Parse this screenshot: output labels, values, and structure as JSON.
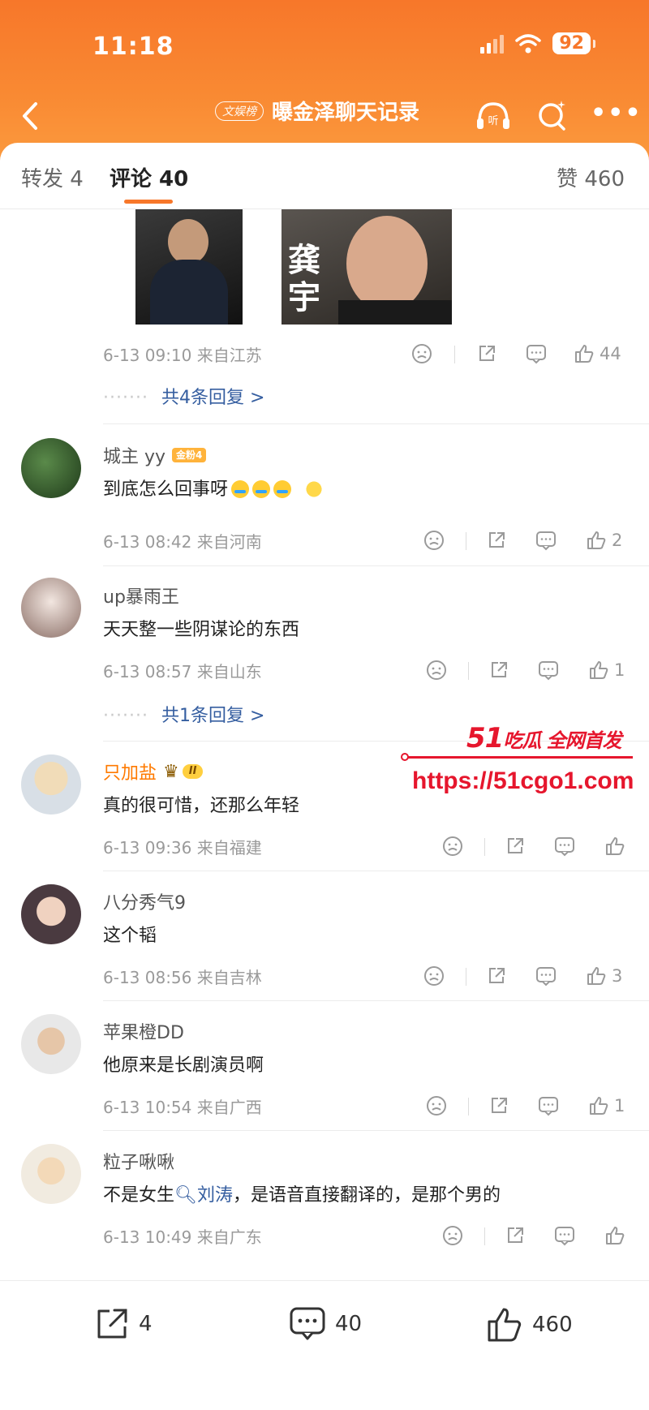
{
  "status_bar": {
    "time": "11:18",
    "battery": "92"
  },
  "nav": {
    "badge": "文娱榜",
    "title": "曝金泽聊天记录"
  },
  "tabs": {
    "repost": "转发 4",
    "comment": "评论 40",
    "like": "赞 460"
  },
  "top_item": {
    "photo_label": "龚宇",
    "meta": "6-13 09:10 来自江苏",
    "likes": "44",
    "replies": "共4条回复 >"
  },
  "comments": [
    {
      "name": "城主 yy",
      "badge": "金粉4",
      "text": "到底怎么回事呀",
      "meta": "6-13 08:42 来自河南",
      "likes": "2"
    },
    {
      "name": "up暴雨王",
      "text": "天天整一些阴谋论的东西",
      "meta": "6-13 08:57 来自山东",
      "likes": "1",
      "replies": "共1条回复 >"
    },
    {
      "name": "只加盐",
      "badge": "II",
      "text": "真的很可惜，还那么年轻",
      "meta": "6-13 09:36 来自福建",
      "likes": ""
    },
    {
      "name": "八分秀气9",
      "text": "这个韬",
      "meta": "6-13 08:56 来自吉林",
      "likes": "3"
    },
    {
      "name": "苹果橙DD",
      "text": "他原来是长剧演员啊",
      "meta": "6-13 10:54 来自广西",
      "likes": "1"
    },
    {
      "name": "粒子啾啾",
      "text_a": "不是女生",
      "search_term": "刘涛",
      "text_b": "，是语音直接翻译的，是那个男的",
      "meta": "6-13 10:49 来自广东",
      "likes": ""
    }
  ],
  "watermark": {
    "brand_num": "51",
    "brand_text": "吃瓜 全网首发",
    "url": "https://51cgo1.com"
  },
  "bottom_bar": {
    "repost": "4",
    "comment": "40",
    "like": "460"
  },
  "colors": {
    "accent": "#f7772a",
    "link": "#355ea0",
    "vip_name": "#ff7a00",
    "watermark": "#e6162d"
  }
}
